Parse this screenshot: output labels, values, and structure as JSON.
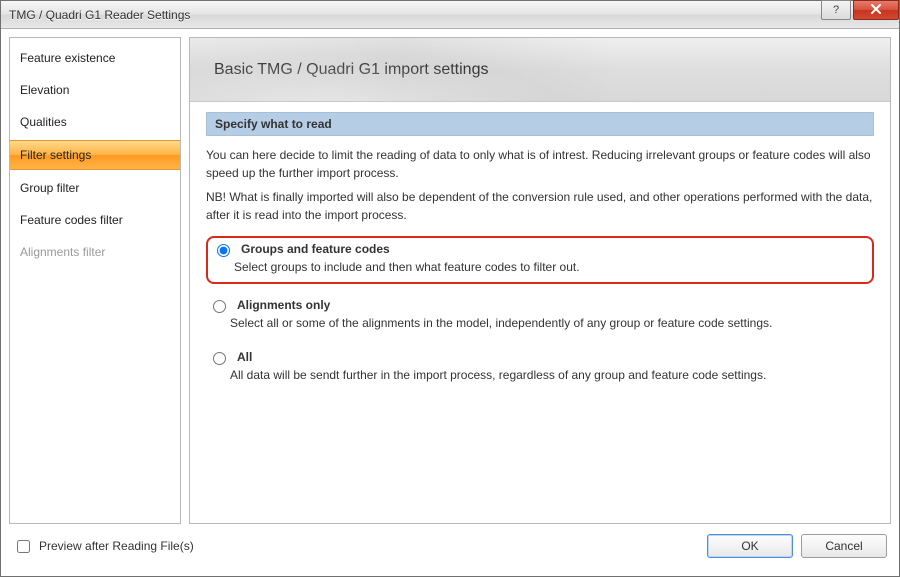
{
  "window": {
    "title": "TMG / Quadri G1 Reader Settings"
  },
  "sidebar": {
    "items": [
      {
        "label": "Feature existence",
        "selected": false,
        "disabled": false
      },
      {
        "label": "Elevation",
        "selected": false,
        "disabled": false
      },
      {
        "label": "Qualities",
        "selected": false,
        "disabled": false
      },
      {
        "label": "Filter settings",
        "selected": true,
        "disabled": false
      },
      {
        "label": "Group filter",
        "selected": false,
        "disabled": false
      },
      {
        "label": "Feature codes filter",
        "selected": false,
        "disabled": false
      },
      {
        "label": "Alignments filter",
        "selected": false,
        "disabled": true
      }
    ]
  },
  "content": {
    "heading": "Basic TMG / Quadri G1 import settings",
    "section_title": "Specify what to read",
    "intro1": "You can here decide to limit the reading of data to only what is of intrest. Reducing irrelevant groups or feature codes will also speed up the further import process.",
    "intro2": "NB! What is finally imported will also be dependent of the conversion rule used, and other operations performed with the data, after it is read into the import process.",
    "options": {
      "groups": {
        "title": "Groups and feature codes",
        "sub": "Select groups to include and then what feature codes to filter out.",
        "checked": true
      },
      "alignments": {
        "title": "Alignments only",
        "sub": "Select all or some of the alignments in the model, independently of any group or feature code settings.",
        "checked": false
      },
      "all": {
        "title": "All",
        "sub": "All data will be sendt further in the import process, regardless of any group and feature code settings.",
        "checked": false
      }
    }
  },
  "footer": {
    "preview_label": "Preview after Reading File(s)",
    "ok": "OK",
    "cancel": "Cancel"
  }
}
